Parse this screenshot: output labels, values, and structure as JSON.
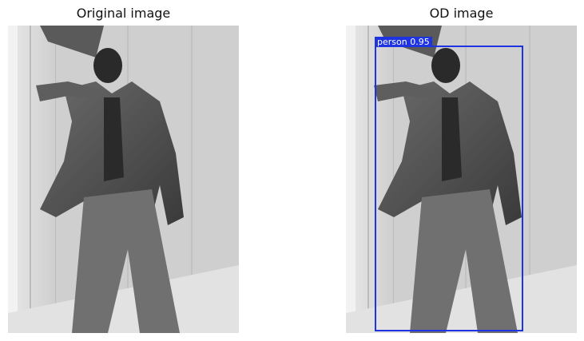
{
  "panels": {
    "original": {
      "title": "Original image"
    },
    "od": {
      "title": "OD image",
      "detection": {
        "label": "person",
        "score": "0.95",
        "color": "#1d34e0"
      }
    }
  }
}
